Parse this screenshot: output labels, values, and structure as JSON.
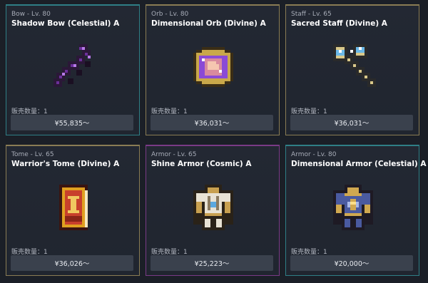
{
  "items": [
    {
      "category": "Bow - Lv. 80",
      "name": "Shadow Bow (Celestial) A",
      "quantity": "販売数量：1",
      "price": "¥55,835～",
      "icon": "bow-icon",
      "border_color": "#2f7f86"
    },
    {
      "category": "Orb - Lv. 80",
      "name": "Dimensional Orb (Divine) A",
      "quantity": "販売数量：1",
      "price": "¥36,031～",
      "icon": "orb-icon",
      "border_color": "#8a7c54"
    },
    {
      "category": "Staff - Lv. 65",
      "name": "Sacred Staff (Divine) A",
      "quantity": "販売数量：1",
      "price": "¥36,031～",
      "icon": "staff-icon",
      "border_color": "#8a7c54"
    },
    {
      "category": "Tome - Lv. 65",
      "name": "Warrior's Tome (Divine) A",
      "quantity": "販売数量：1",
      "price": "¥36,026～",
      "icon": "tome-icon",
      "border_color": "#8a7c54"
    },
    {
      "category": "Armor - Lv. 65",
      "name": "Shine Armor (Cosmic) A",
      "quantity": "販売数量：1",
      "price": "¥25,223～",
      "icon": "armor-icon",
      "border_color": "#7a3a86"
    },
    {
      "category": "Armor - Lv. 80",
      "name": "Dimensional Armor (Celestial) A",
      "quantity": "販売数量：1",
      "price": "¥20,000～",
      "icon": "armor-icon",
      "border_color": "#2f7f86"
    }
  ]
}
